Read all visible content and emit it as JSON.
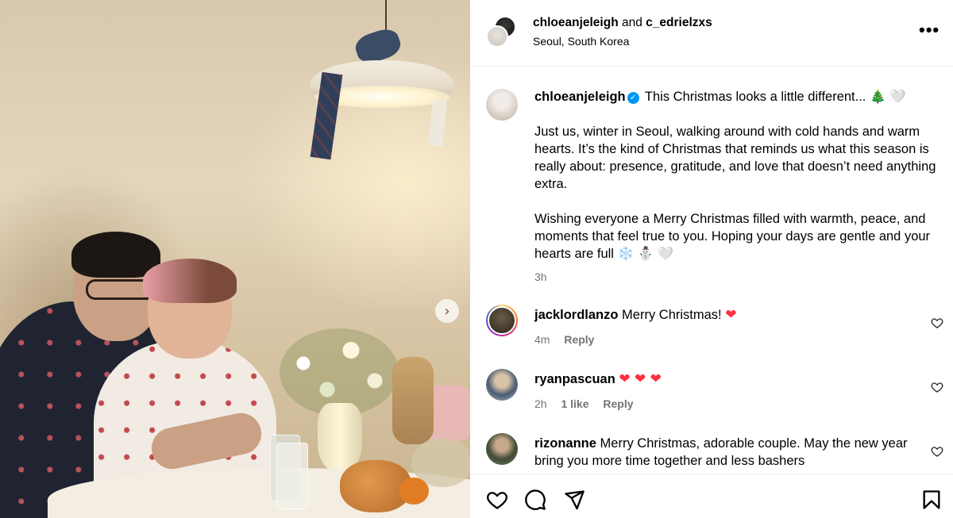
{
  "media": {
    "next_symbol": "›"
  },
  "header": {
    "user1": "chloeanjeleigh",
    "joiner": "and",
    "user2": "c_edrielzxs",
    "location": "Seoul, South Korea",
    "more_symbol": "•••"
  },
  "caption": {
    "username": "chloeanjeleigh",
    "verified_symbol": "✓",
    "line1": "This Christmas looks a little different... 🎄 🤍",
    "para1": "Just us, winter in Seoul, walking around with cold hands and warm hearts. It’s the kind of Christmas that reminds us what this season is really about: presence, gratitude, and love that doesn’t need anything extra.",
    "para2": "Wishing everyone a Merry Christmas filled with warmth, peace, and moments that feel true to you. Hoping your days are gentle and your hearts are full ❄️ ⛄ 🤍",
    "time": "3h"
  },
  "comments": [
    {
      "username": "jacklordlanzo",
      "text": "Merry Christmas!",
      "emoji": "❤",
      "time": "4m",
      "likes": "",
      "reply_label": "Reply"
    },
    {
      "username": "ryanpascuan",
      "text": "",
      "emoji": "❤ ❤ ❤",
      "time": "2h",
      "likes": "1 like",
      "reply_label": "Reply"
    },
    {
      "username": "rizonanne",
      "text": "Merry Christmas, adorable couple. May the new year bring you more time together and less bashers",
      "emoji": ""
    }
  ],
  "colors": {
    "verified": "#0095f6",
    "heart_red": "#ff3040",
    "muted_text": "#737373"
  },
  "icons": [
    "more-options-icon",
    "verified-icon",
    "heart-outline-icon",
    "like-icon",
    "comment-icon",
    "share-icon",
    "save-icon",
    "chevron-right-icon"
  ]
}
